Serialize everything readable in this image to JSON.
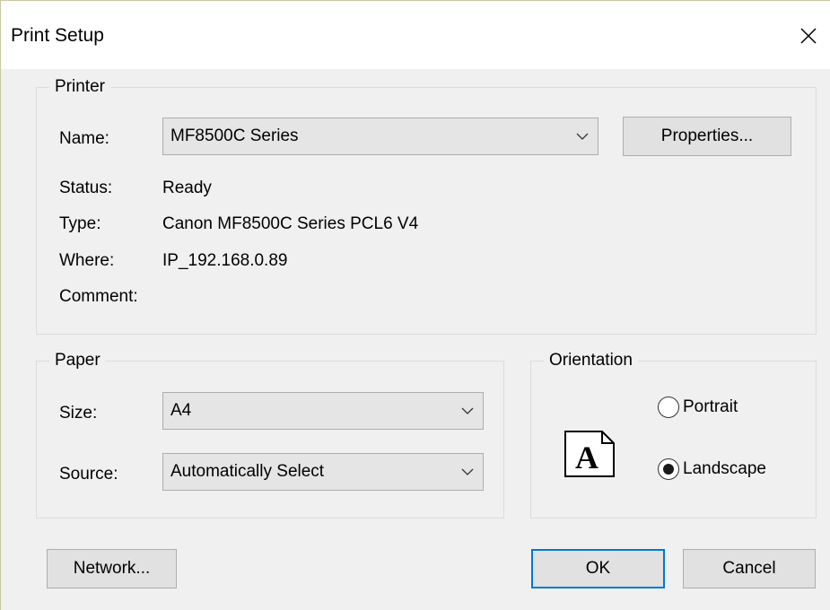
{
  "window": {
    "title": "Print Setup"
  },
  "printer": {
    "legend": "Printer",
    "name_label": "Name:",
    "name_value": "MF8500C Series",
    "properties_button": "Properties...",
    "status_label": "Status:",
    "status_value": "Ready",
    "type_label": "Type:",
    "type_value": "Canon MF8500C Series PCL6 V4",
    "where_label": "Where:",
    "where_value": "IP_192.168.0.89",
    "comment_label": "Comment:",
    "comment_value": ""
  },
  "paper": {
    "legend": "Paper",
    "size_label": "Size:",
    "size_value": "A4",
    "source_label": "Source:",
    "source_value": "Automatically Select"
  },
  "orientation": {
    "legend": "Orientation",
    "portrait_label": "Portrait",
    "landscape_label": "Landscape",
    "selected": "Landscape",
    "preview_letter": "A"
  },
  "buttons": {
    "network": "Network...",
    "ok": "OK",
    "cancel": "Cancel"
  }
}
